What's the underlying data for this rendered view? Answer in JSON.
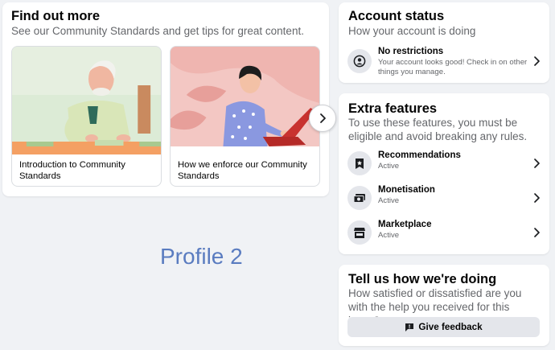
{
  "find_out_more": {
    "title": "Find out more",
    "subtitle": "See our Community Standards and get tips for great content.",
    "articles": [
      {
        "caption": "Introduction to Community Standards",
        "image": "older-man-reading-illustration"
      },
      {
        "caption": "How we enforce our Community Standards",
        "image": "woman-at-laptop-illustration"
      }
    ],
    "next_icon": "chevron-right-icon"
  },
  "watermark": "Profile 2",
  "account_status": {
    "title": "Account status",
    "subtitle": "How your account is doing",
    "item": {
      "title": "No restrictions",
      "description": "Your account looks good! Check in on other things you manage.",
      "icon": "person-circle-icon"
    }
  },
  "extra_features": {
    "title": "Extra features",
    "subtitle": "To use these features, you must be eligible and avoid breaking any rules.",
    "items": [
      {
        "title": "Recommendations",
        "status": "Active",
        "icon": "star-badge-icon"
      },
      {
        "title": "Monetisation",
        "status": "Active",
        "icon": "money-icon"
      },
      {
        "title": "Marketplace",
        "status": "Active",
        "icon": "shop-icon"
      }
    ]
  },
  "feedback": {
    "title": "Tell us how we're doing",
    "subtitle": "How satisfied or dissatisfied are you with the help you received for this issue?",
    "button_label": "Give feedback",
    "button_icon": "feedback-icon"
  },
  "colors": {
    "background": "#f0f2f5",
    "card": "#ffffff",
    "secondary_text": "#65676b",
    "watermark": "#5a7cc0",
    "button_gray": "#e4e6eb"
  }
}
